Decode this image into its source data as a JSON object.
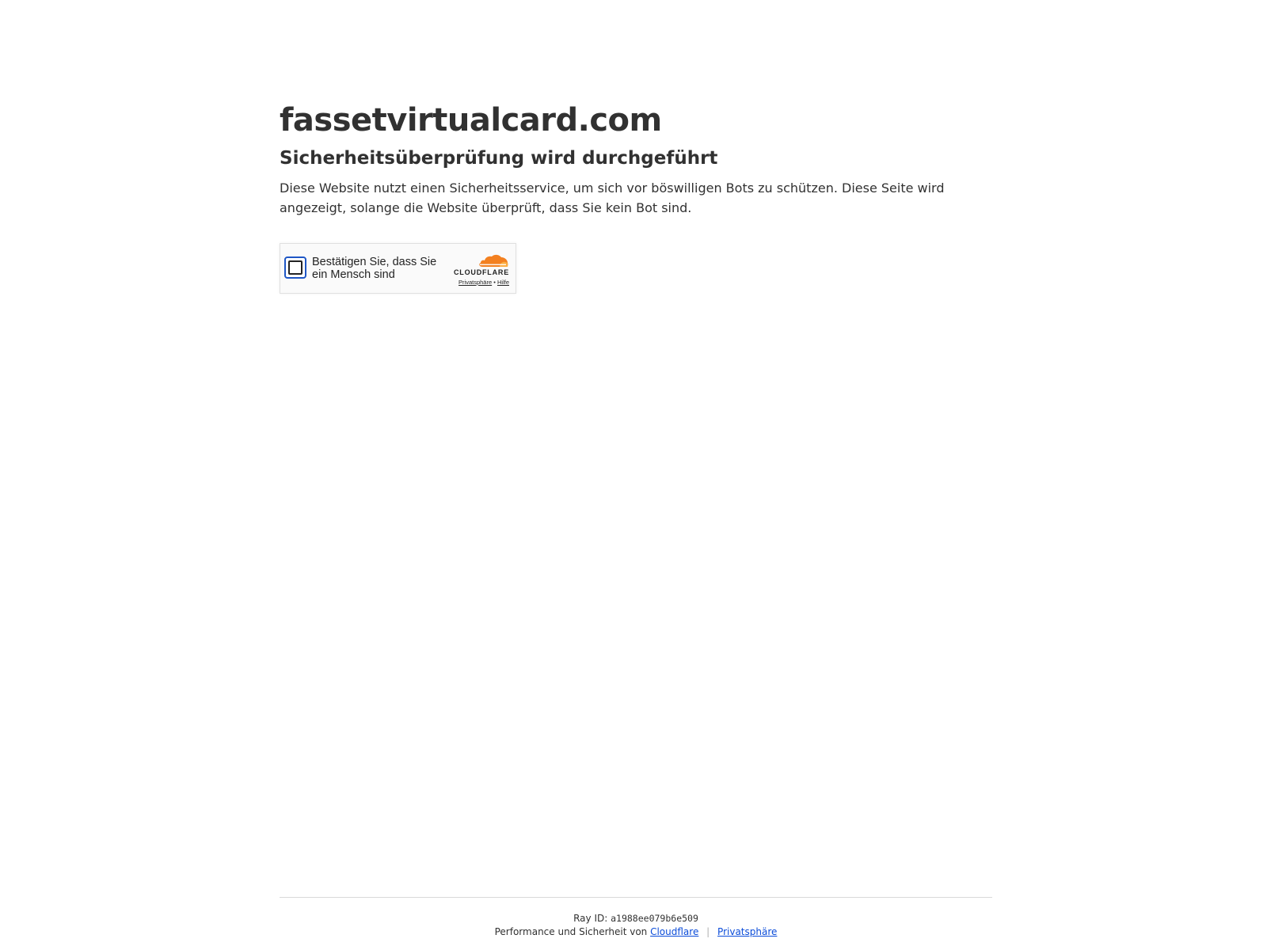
{
  "header": {
    "site_title": "fassetvirtualcard.com",
    "subtitle": "Sicherheitsüberprüfung wird durchgeführt",
    "description": "Diese Website nutzt einen Sicherheitsservice, um sich vor böswilligen Bots zu schützen. Diese Seite wird angezeigt, solange die Website überprüft, dass Sie kein Bot sind."
  },
  "challenge": {
    "label": "Bestätigen Sie, dass Sie ein Mensch sind",
    "checkbox_checked": false,
    "brand": "CLOUDFLARE",
    "privacy_link": "Privatsphäre",
    "link_separator": "•",
    "help_link": "Hilfe",
    "accent_color": "#f38020",
    "checkbox_border_color": "#1e56c5"
  },
  "footer": {
    "ray_label": "Ray ID:",
    "ray_id": "a1988ee079b6e509",
    "perf_text": "Performance und Sicherheit von",
    "cloudflare_link": "Cloudflare",
    "separator": "|",
    "privacy_link": "Privatsphäre",
    "link_color": "#0b4cd9"
  }
}
